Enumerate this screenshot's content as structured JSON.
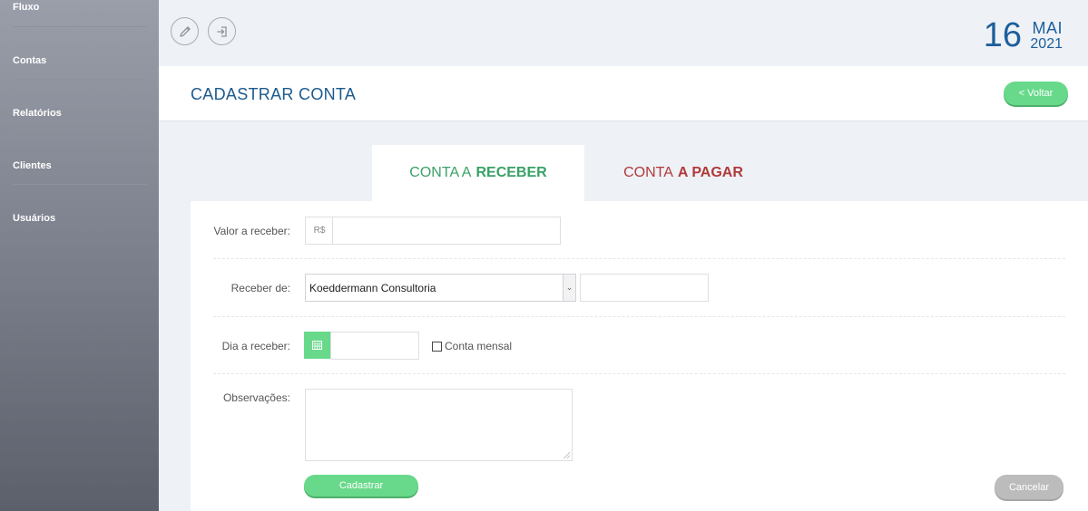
{
  "sidebar": {
    "items": [
      {
        "label": "Fluxo"
      },
      {
        "label": "Contas"
      },
      {
        "label": "Relatórios"
      },
      {
        "label": "Clientes"
      },
      {
        "label": "Usuários"
      }
    ]
  },
  "header": {
    "icons": [
      "pencil-icon",
      "sign-in-icon"
    ],
    "date": {
      "day": "16",
      "month": "MAI",
      "year": "2021"
    },
    "brand_color": "#1d5f9b"
  },
  "page": {
    "title": "CADASTRAR CONTA",
    "back_button": "< Voltar"
  },
  "tabs": {
    "receber": {
      "prefix": "CONTA A",
      "strong": "RECEBER",
      "color": "#3aa166",
      "active": true
    },
    "pagar": {
      "prefix": "CONTA",
      "strong": "A PAGAR",
      "color": "#b03a3a",
      "active": false
    }
  },
  "form": {
    "valor_label": "Valor a receber:",
    "currency_prefix": "R$",
    "valor_value": "",
    "receber_de_label": "Receber de:",
    "receber_de_selected": "Koeddermann Consultoria",
    "receber_de_extra_value": "",
    "dia_label": "Dia a receber:",
    "dia_value": "",
    "conta_mensal_label": "Conta mensal",
    "conta_mensal_checked": false,
    "observacoes_label": "Observações:",
    "observacoes_value": "",
    "submit_button": "Cadastrar",
    "cancel_button": "Cancelar"
  },
  "colors": {
    "accent_green": "#68d98a",
    "receber_green": "#3aa166",
    "pagar_red": "#b03a3a",
    "cancel_gray": "#bcbcbc"
  }
}
